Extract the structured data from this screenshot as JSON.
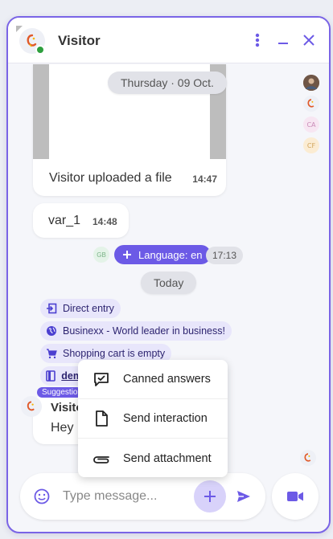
{
  "header": {
    "title": "Visitor"
  },
  "participants": [
    {
      "initials": ""
    },
    {
      "initials": ""
    },
    {
      "initials": "CA"
    },
    {
      "initials": "CF"
    }
  ],
  "messages": {
    "upload_text": "Visitor uploaded a file",
    "upload_time": "14:47",
    "date_thursday": "Thursday · 09 Oct.",
    "var_text": "var_1",
    "var_time": "14:48",
    "language_initials": "GB",
    "language_label": "Language: en",
    "language_time": "17:13",
    "date_today": "Today"
  },
  "chips": [
    {
      "label": "Direct entry",
      "icon": "entry-icon"
    },
    {
      "label": "Businexx - World leader in business!",
      "icon": "globe-icon"
    },
    {
      "label": "Shopping cart is empty",
      "icon": "cart-icon"
    },
    {
      "label": "dem",
      "icon": "document-icon"
    }
  ],
  "suggestion": {
    "tag": "Suggestio",
    "name": "Visitor",
    "text": "Hey"
  },
  "menu": {
    "items": [
      {
        "label": "Canned answers",
        "icon": "canned-answers-icon"
      },
      {
        "label": "Send interaction",
        "icon": "document-icon"
      },
      {
        "label": "Send attachment",
        "icon": "paperclip-icon"
      }
    ]
  },
  "composer": {
    "placeholder": "Type message..."
  },
  "colors": {
    "accent": "#6c5ae6",
    "border": "#7a64e6",
    "online": "#2e9f3e"
  }
}
